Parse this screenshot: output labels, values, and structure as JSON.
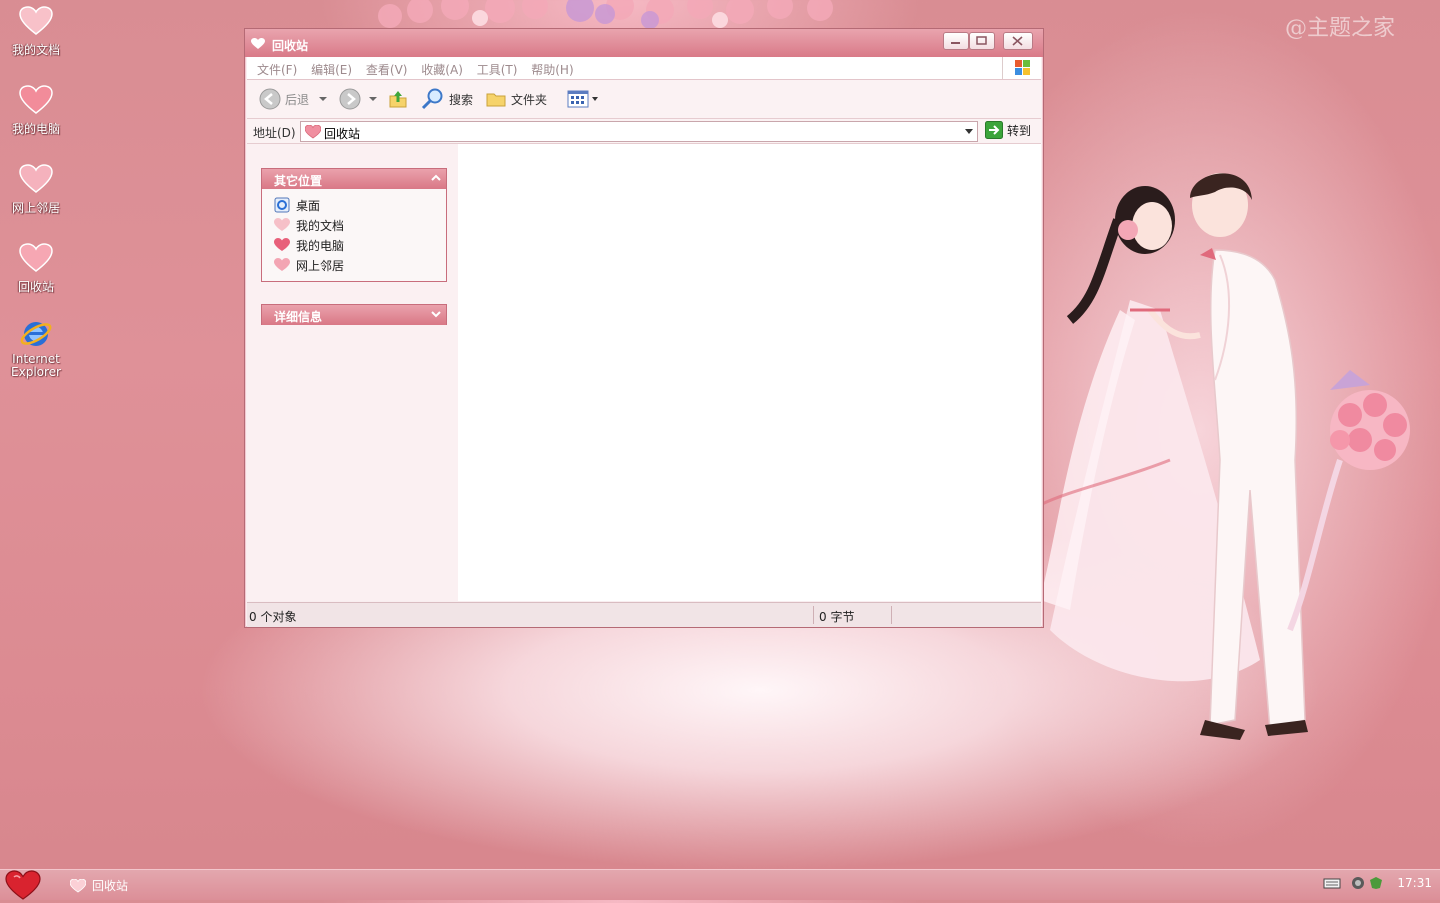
{
  "desktop": {
    "icons": [
      {
        "label": "我的文档"
      },
      {
        "label": "我的电脑"
      },
      {
        "label": "网上邻居"
      },
      {
        "label": "回收站"
      },
      {
        "label_line1": "Internet",
        "label_line2": "Explorer"
      }
    ],
    "watermark": "@主题之家"
  },
  "window": {
    "title": "回收站",
    "menu": [
      "文件(F)",
      "编辑(E)",
      "查看(V)",
      "收藏(A)",
      "工具(T)",
      "帮助(H)"
    ],
    "toolbar": {
      "back_label": "后退",
      "search_label": "搜索",
      "folders_label": "文件夹"
    },
    "address": {
      "label": "地址(D)",
      "value": "回收站",
      "go_label": "转到"
    },
    "panels": {
      "other_places": {
        "title": "其它位置",
        "items": [
          "桌面",
          "我的文档",
          "我的电脑",
          "网上邻居"
        ]
      },
      "details": {
        "title": "详细信息"
      }
    },
    "status": {
      "objects": "0 个对象",
      "size": "0 字节"
    }
  },
  "taskbar": {
    "task_label": "回收站",
    "clock": "17:31"
  },
  "colors": {
    "accent": "#d97a88",
    "desktop_bg": "#dc8b92",
    "panel_border": "#c86d7c"
  }
}
